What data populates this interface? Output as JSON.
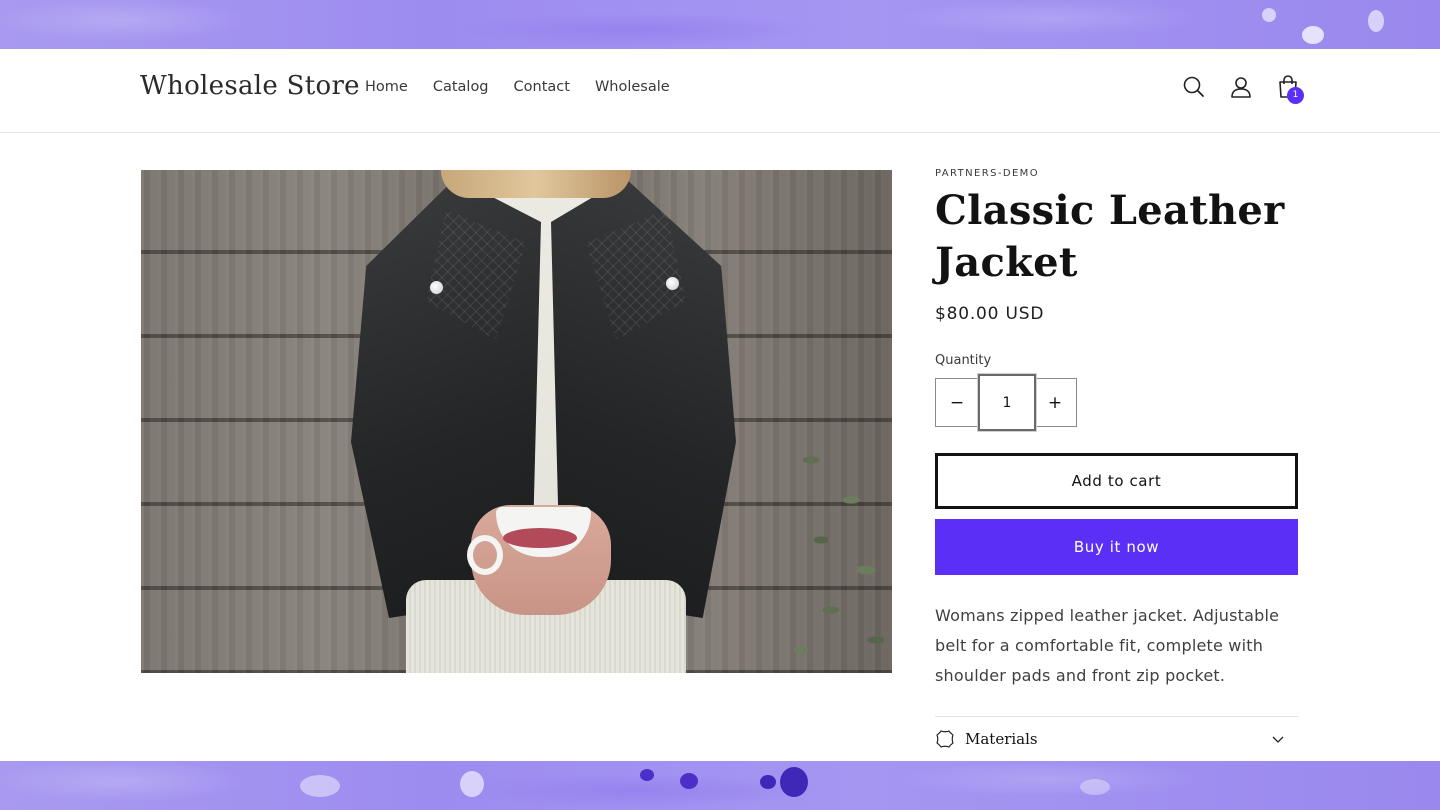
{
  "store": {
    "name": "Wholesale Store"
  },
  "nav": {
    "items": [
      {
        "label": "Home"
      },
      {
        "label": "Catalog"
      },
      {
        "label": "Contact"
      },
      {
        "label": "Wholesale"
      }
    ]
  },
  "header_icons": {
    "search": "search-icon",
    "account": "account-icon",
    "cart": "cart-icon",
    "cart_count": "1"
  },
  "product": {
    "vendor": "PARTNERS-DEMO",
    "title": "Classic Leather Jacket",
    "price": "$80.00 USD",
    "quantity_label": "Quantity",
    "quantity_value": "1",
    "minus_symbol": "−",
    "plus_symbol": "+",
    "add_to_cart": "Add to cart",
    "buy_now": "Buy it now",
    "description": "Womans zipped leather jacket. Adjustable belt for a comfortable fit, complete with shoulder pads and front zip pocket.",
    "accordion": {
      "label": "Materials",
      "icon": "leather-icon"
    }
  },
  "colors": {
    "accent": "#5b2ff5",
    "band": "#a596f2",
    "text": "#121212"
  }
}
